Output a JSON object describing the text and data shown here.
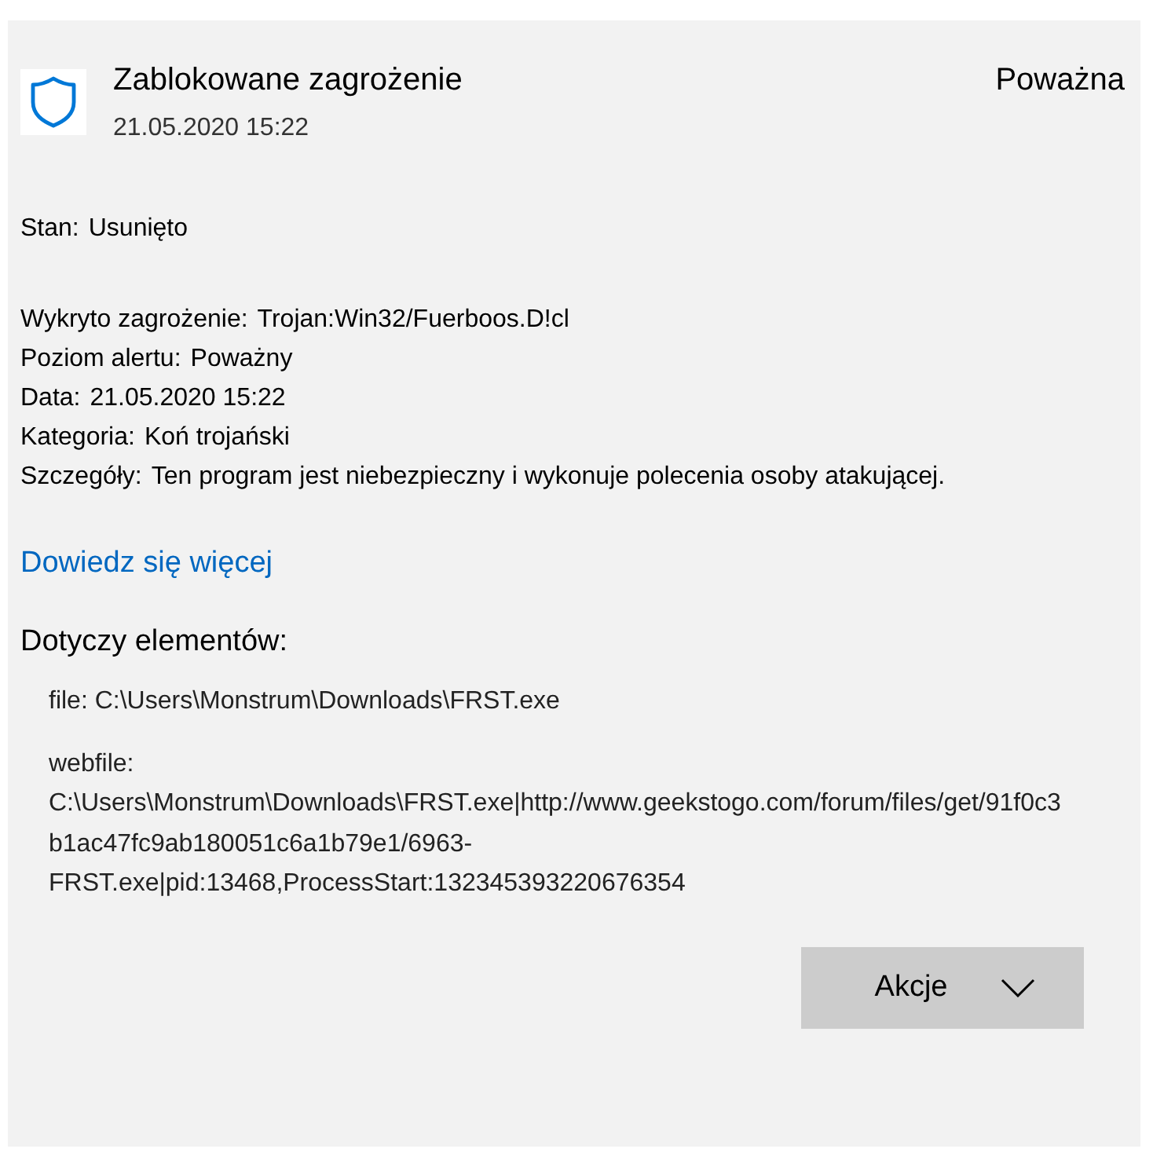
{
  "header": {
    "title": "Zablokowane zagrożenie",
    "date": "21.05.2020 15:22",
    "severity": "Poważna"
  },
  "status": {
    "label": "Stan:",
    "value": "Usunięto"
  },
  "details": [
    {
      "label": "Wykryto zagrożenie:",
      "value": "Trojan:Win32/Fuerboos.D!cl"
    },
    {
      "label": "Poziom alertu:",
      "value": "Poważny"
    },
    {
      "label": "Data:",
      "value": "21.05.2020 15:22"
    },
    {
      "label": "Kategoria:",
      "value": "Koń trojański"
    },
    {
      "label": "Szczegóły:",
      "value": "Ten program jest niebezpieczny i wykonuje polecenia osoby atakującej."
    }
  ],
  "link": "Dowiedz się więcej",
  "affected": {
    "heading": "Dotyczy elementów:",
    "items": [
      "file: C:\\Users\\Monstrum\\Downloads\\FRST.exe",
      "webfile: C:\\Users\\Monstrum\\Downloads\\FRST.exe|http://www.geekstogo.com/forum/files/get/91f0c3b1ac47fc9ab180051c6a1b79e1/6963-FRST.exe|pid:13468,ProcessStart:132345393220676354"
    ]
  },
  "actions_button": {
    "label": "Akcje"
  }
}
